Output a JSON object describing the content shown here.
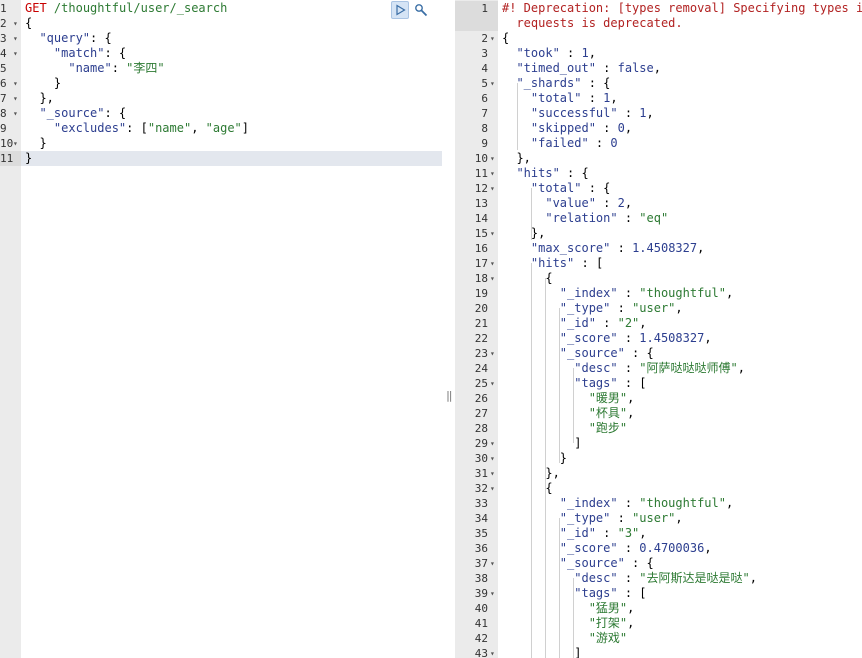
{
  "request_editor": {
    "lines": [
      {
        "n": "1",
        "tokens": [
          {
            "t": "GET",
            "c": "m"
          },
          {
            "t": " ",
            "c": "p"
          },
          {
            "t": "/thoughtful/user/_search",
            "c": "u"
          }
        ]
      },
      {
        "n": "2",
        "fold": true,
        "tokens": [
          {
            "t": "{",
            "c": "p"
          }
        ]
      },
      {
        "n": "3",
        "fold": true,
        "tokens": [
          {
            "t": "  ",
            "c": "p"
          },
          {
            "t": "\"query\"",
            "c": "k"
          },
          {
            "t": ": {",
            "c": "p"
          }
        ]
      },
      {
        "n": "4",
        "fold": true,
        "tokens": [
          {
            "t": "    ",
            "c": "p"
          },
          {
            "t": "\"match\"",
            "c": "k"
          },
          {
            "t": ": {",
            "c": "p"
          }
        ]
      },
      {
        "n": "5",
        "tokens": [
          {
            "t": "      ",
            "c": "p"
          },
          {
            "t": "\"name\"",
            "c": "k"
          },
          {
            "t": ": ",
            "c": "p"
          },
          {
            "t": "\"李四\"",
            "c": "s"
          }
        ]
      },
      {
        "n": "6",
        "fold": true,
        "tokens": [
          {
            "t": "    }",
            "c": "p"
          }
        ]
      },
      {
        "n": "7",
        "fold": true,
        "tokens": [
          {
            "t": "  },",
            "c": "p"
          }
        ]
      },
      {
        "n": "8",
        "fold": true,
        "tokens": [
          {
            "t": "  ",
            "c": "p"
          },
          {
            "t": "\"_source\"",
            "c": "k"
          },
          {
            "t": ": {",
            "c": "p"
          }
        ]
      },
      {
        "n": "9",
        "tokens": [
          {
            "t": "    ",
            "c": "p"
          },
          {
            "t": "\"excludes\"",
            "c": "k"
          },
          {
            "t": ": [",
            "c": "p"
          },
          {
            "t": "\"name\"",
            "c": "s"
          },
          {
            "t": ", ",
            "c": "p"
          },
          {
            "t": "\"age\"",
            "c": "s"
          },
          {
            "t": "]",
            "c": "p"
          }
        ]
      },
      {
        "n": "10",
        "fold": true,
        "tokens": [
          {
            "t": "  }",
            "c": "p"
          }
        ]
      },
      {
        "n": "11",
        "tokens": [
          {
            "t": "}",
            "c": "p"
          }
        ]
      }
    ],
    "toolbar": {
      "run_icon": "play-icon",
      "settings_icon": "wrench-icon"
    }
  },
  "response_viewer": {
    "lines": [
      {
        "n": "1",
        "tokens": [
          {
            "t": "#! Deprecation: [types removal] Specifying types in s",
            "c": "w"
          }
        ]
      },
      {
        "n": "",
        "tokens": [
          {
            "t": "  requests is deprecated.",
            "c": "w"
          }
        ]
      },
      {
        "n": "2",
        "fold": true,
        "tokens": [
          {
            "t": "{",
            "c": "p"
          }
        ]
      },
      {
        "n": "3",
        "tokens": [
          {
            "t": "  ",
            "c": "p"
          },
          {
            "t": "\"took\"",
            "c": "k"
          },
          {
            "t": " : ",
            "c": "p"
          },
          {
            "t": "1",
            "c": "n"
          },
          {
            "t": ",",
            "c": "p"
          }
        ]
      },
      {
        "n": "4",
        "tokens": [
          {
            "t": "  ",
            "c": "p"
          },
          {
            "t": "\"timed_out\"",
            "c": "k"
          },
          {
            "t": " : ",
            "c": "p"
          },
          {
            "t": "false",
            "c": "b"
          },
          {
            "t": ",",
            "c": "p"
          }
        ]
      },
      {
        "n": "5",
        "fold": true,
        "tokens": [
          {
            "t": "  ",
            "c": "p"
          },
          {
            "t": "\"_shards\"",
            "c": "k"
          },
          {
            "t": " : {",
            "c": "p"
          }
        ]
      },
      {
        "n": "6",
        "tokens": [
          {
            "t": "    ",
            "c": "p"
          },
          {
            "t": "\"total\"",
            "c": "k"
          },
          {
            "t": " : ",
            "c": "p"
          },
          {
            "t": "1",
            "c": "n"
          },
          {
            "t": ",",
            "c": "p"
          }
        ]
      },
      {
        "n": "7",
        "tokens": [
          {
            "t": "    ",
            "c": "p"
          },
          {
            "t": "\"successful\"",
            "c": "k"
          },
          {
            "t": " : ",
            "c": "p"
          },
          {
            "t": "1",
            "c": "n"
          },
          {
            "t": ",",
            "c": "p"
          }
        ]
      },
      {
        "n": "8",
        "tokens": [
          {
            "t": "    ",
            "c": "p"
          },
          {
            "t": "\"skipped\"",
            "c": "k"
          },
          {
            "t": " : ",
            "c": "p"
          },
          {
            "t": "0",
            "c": "n"
          },
          {
            "t": ",",
            "c": "p"
          }
        ]
      },
      {
        "n": "9",
        "tokens": [
          {
            "t": "    ",
            "c": "p"
          },
          {
            "t": "\"failed\"",
            "c": "k"
          },
          {
            "t": " : ",
            "c": "p"
          },
          {
            "t": "0",
            "c": "n"
          }
        ]
      },
      {
        "n": "10",
        "fold": true,
        "tokens": [
          {
            "t": "  },",
            "c": "p"
          }
        ]
      },
      {
        "n": "11",
        "fold": true,
        "tokens": [
          {
            "t": "  ",
            "c": "p"
          },
          {
            "t": "\"hits\"",
            "c": "k"
          },
          {
            "t": " : {",
            "c": "p"
          }
        ]
      },
      {
        "n": "12",
        "fold": true,
        "tokens": [
          {
            "t": "    ",
            "c": "p"
          },
          {
            "t": "\"total\"",
            "c": "k"
          },
          {
            "t": " : {",
            "c": "p"
          }
        ]
      },
      {
        "n": "13",
        "tokens": [
          {
            "t": "      ",
            "c": "p"
          },
          {
            "t": "\"value\"",
            "c": "k"
          },
          {
            "t": " : ",
            "c": "p"
          },
          {
            "t": "2",
            "c": "n"
          },
          {
            "t": ",",
            "c": "p"
          }
        ]
      },
      {
        "n": "14",
        "tokens": [
          {
            "t": "      ",
            "c": "p"
          },
          {
            "t": "\"relation\"",
            "c": "k"
          },
          {
            "t": " : ",
            "c": "p"
          },
          {
            "t": "\"eq\"",
            "c": "s"
          }
        ]
      },
      {
        "n": "15",
        "fold": true,
        "tokens": [
          {
            "t": "    },",
            "c": "p"
          }
        ]
      },
      {
        "n": "16",
        "tokens": [
          {
            "t": "    ",
            "c": "p"
          },
          {
            "t": "\"max_score\"",
            "c": "k"
          },
          {
            "t": " : ",
            "c": "p"
          },
          {
            "t": "1.4508327",
            "c": "n"
          },
          {
            "t": ",",
            "c": "p"
          }
        ]
      },
      {
        "n": "17",
        "fold": true,
        "tokens": [
          {
            "t": "    ",
            "c": "p"
          },
          {
            "t": "\"hits\"",
            "c": "k"
          },
          {
            "t": " : [",
            "c": "p"
          }
        ]
      },
      {
        "n": "18",
        "fold": true,
        "tokens": [
          {
            "t": "      {",
            "c": "p"
          }
        ]
      },
      {
        "n": "19",
        "tokens": [
          {
            "t": "        ",
            "c": "p"
          },
          {
            "t": "\"_index\"",
            "c": "k"
          },
          {
            "t": " : ",
            "c": "p"
          },
          {
            "t": "\"thoughtful\"",
            "c": "s"
          },
          {
            "t": ",",
            "c": "p"
          }
        ]
      },
      {
        "n": "20",
        "tokens": [
          {
            "t": "        ",
            "c": "p"
          },
          {
            "t": "\"_type\"",
            "c": "k"
          },
          {
            "t": " : ",
            "c": "p"
          },
          {
            "t": "\"user\"",
            "c": "s"
          },
          {
            "t": ",",
            "c": "p"
          }
        ]
      },
      {
        "n": "21",
        "tokens": [
          {
            "t": "        ",
            "c": "p"
          },
          {
            "t": "\"_id\"",
            "c": "k"
          },
          {
            "t": " : ",
            "c": "p"
          },
          {
            "t": "\"2\"",
            "c": "s"
          },
          {
            "t": ",",
            "c": "p"
          }
        ]
      },
      {
        "n": "22",
        "tokens": [
          {
            "t": "        ",
            "c": "p"
          },
          {
            "t": "\"_score\"",
            "c": "k"
          },
          {
            "t": " : ",
            "c": "p"
          },
          {
            "t": "1.4508327",
            "c": "n"
          },
          {
            "t": ",",
            "c": "p"
          }
        ]
      },
      {
        "n": "23",
        "fold": true,
        "tokens": [
          {
            "t": "        ",
            "c": "p"
          },
          {
            "t": "\"_source\"",
            "c": "k"
          },
          {
            "t": " : {",
            "c": "p"
          }
        ]
      },
      {
        "n": "24",
        "tokens": [
          {
            "t": "          ",
            "c": "p"
          },
          {
            "t": "\"desc\"",
            "c": "k"
          },
          {
            "t": " : ",
            "c": "p"
          },
          {
            "t": "\"阿萨哒哒哒师傅\"",
            "c": "s"
          },
          {
            "t": ",",
            "c": "p"
          }
        ]
      },
      {
        "n": "25",
        "fold": true,
        "tokens": [
          {
            "t": "          ",
            "c": "p"
          },
          {
            "t": "\"tags\"",
            "c": "k"
          },
          {
            "t": " : [",
            "c": "p"
          }
        ]
      },
      {
        "n": "26",
        "tokens": [
          {
            "t": "            ",
            "c": "p"
          },
          {
            "t": "\"暖男\"",
            "c": "s"
          },
          {
            "t": ",",
            "c": "p"
          }
        ]
      },
      {
        "n": "27",
        "tokens": [
          {
            "t": "            ",
            "c": "p"
          },
          {
            "t": "\"杯具\"",
            "c": "s"
          },
          {
            "t": ",",
            "c": "p"
          }
        ]
      },
      {
        "n": "28",
        "tokens": [
          {
            "t": "            ",
            "c": "p"
          },
          {
            "t": "\"跑步\"",
            "c": "s"
          }
        ]
      },
      {
        "n": "29",
        "fold": true,
        "tokens": [
          {
            "t": "          ]",
            "c": "p"
          }
        ]
      },
      {
        "n": "30",
        "fold": true,
        "tokens": [
          {
            "t": "        }",
            "c": "p"
          }
        ]
      },
      {
        "n": "31",
        "fold": true,
        "tokens": [
          {
            "t": "      },",
            "c": "p"
          }
        ]
      },
      {
        "n": "32",
        "fold": true,
        "tokens": [
          {
            "t": "      {",
            "c": "p"
          }
        ]
      },
      {
        "n": "33",
        "tokens": [
          {
            "t": "        ",
            "c": "p"
          },
          {
            "t": "\"_index\"",
            "c": "k"
          },
          {
            "t": " : ",
            "c": "p"
          },
          {
            "t": "\"thoughtful\"",
            "c": "s"
          },
          {
            "t": ",",
            "c": "p"
          }
        ]
      },
      {
        "n": "34",
        "tokens": [
          {
            "t": "        ",
            "c": "p"
          },
          {
            "t": "\"_type\"",
            "c": "k"
          },
          {
            "t": " : ",
            "c": "p"
          },
          {
            "t": "\"user\"",
            "c": "s"
          },
          {
            "t": ",",
            "c": "p"
          }
        ]
      },
      {
        "n": "35",
        "tokens": [
          {
            "t": "        ",
            "c": "p"
          },
          {
            "t": "\"_id\"",
            "c": "k"
          },
          {
            "t": " : ",
            "c": "p"
          },
          {
            "t": "\"3\"",
            "c": "s"
          },
          {
            "t": ",",
            "c": "p"
          }
        ]
      },
      {
        "n": "36",
        "tokens": [
          {
            "t": "        ",
            "c": "p"
          },
          {
            "t": "\"_score\"",
            "c": "k"
          },
          {
            "t": " : ",
            "c": "p"
          },
          {
            "t": "0.4700036",
            "c": "n"
          },
          {
            "t": ",",
            "c": "p"
          }
        ]
      },
      {
        "n": "37",
        "fold": true,
        "tokens": [
          {
            "t": "        ",
            "c": "p"
          },
          {
            "t": "\"_source\"",
            "c": "k"
          },
          {
            "t": " : {",
            "c": "p"
          }
        ]
      },
      {
        "n": "38",
        "tokens": [
          {
            "t": "          ",
            "c": "p"
          },
          {
            "t": "\"desc\"",
            "c": "k"
          },
          {
            "t": " : ",
            "c": "p"
          },
          {
            "t": "\"去阿斯达是哒是哒\"",
            "c": "s"
          },
          {
            "t": ",",
            "c": "p"
          }
        ]
      },
      {
        "n": "39",
        "fold": true,
        "tokens": [
          {
            "t": "          ",
            "c": "p"
          },
          {
            "t": "\"tags\"",
            "c": "k"
          },
          {
            "t": " : [",
            "c": "p"
          }
        ]
      },
      {
        "n": "40",
        "tokens": [
          {
            "t": "            ",
            "c": "p"
          },
          {
            "t": "\"猛男\"",
            "c": "s"
          },
          {
            "t": ",",
            "c": "p"
          }
        ]
      },
      {
        "n": "41",
        "tokens": [
          {
            "t": "            ",
            "c": "p"
          },
          {
            "t": "\"打架\"",
            "c": "s"
          },
          {
            "t": ",",
            "c": "p"
          }
        ]
      },
      {
        "n": "42",
        "tokens": [
          {
            "t": "            ",
            "c": "p"
          },
          {
            "t": "\"游戏\"",
            "c": "s"
          }
        ]
      },
      {
        "n": "43",
        "fold": true,
        "tokens": [
          {
            "t": "          ]",
            "c": "p"
          }
        ]
      }
    ]
  },
  "splitter": {
    "grip_glyph": "‖"
  },
  "colors": {
    "method": "#c80000",
    "url": "#2d7a33",
    "key": "#2c3e8f",
    "string": "#2d7a33",
    "number": "#2c3e8f",
    "warning": "#b22222",
    "gutter": "#ebebeb",
    "active_line": "#e3e7ee"
  }
}
